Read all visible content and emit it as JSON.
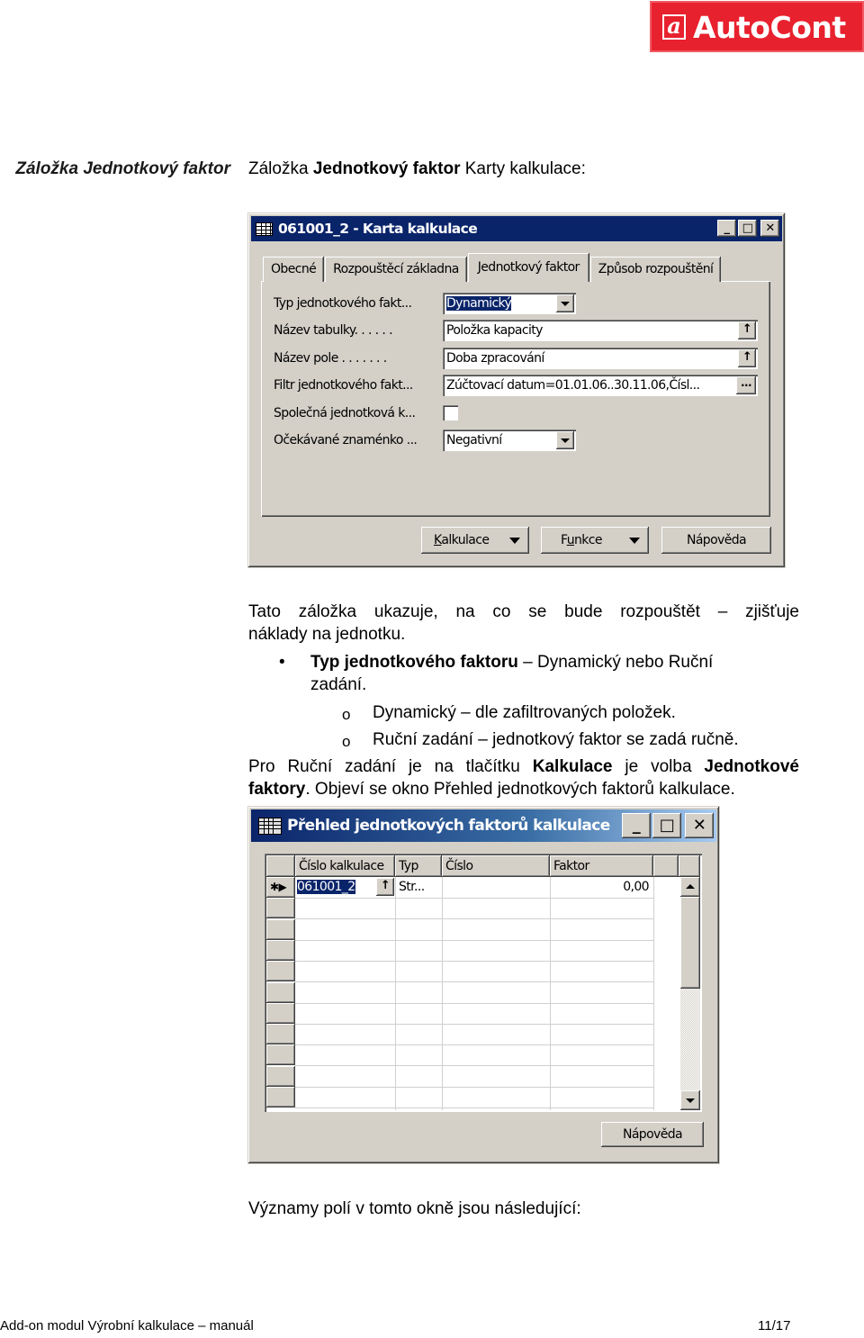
{
  "logo": {
    "mark": "a",
    "text": "AutoCont",
    "color": "#e8212e"
  },
  "side_heading": "Záložka Jednotkový faktor",
  "intro": {
    "prefix": "Záložka ",
    "bold": "Jednotkový faktor",
    "suffix": " Karty kalkulace:"
  },
  "card_window": {
    "title": "061001_2 - Karta kalkulace",
    "title_buttons": {
      "minimize": "_",
      "maximize": "□",
      "close": "✕"
    },
    "tabs": [
      {
        "label": "Obecné",
        "active": false
      },
      {
        "label": "Rozpouštěcí základna",
        "active": false
      },
      {
        "label": "Jednotkový faktor",
        "active": true
      },
      {
        "label": "Způsob rozpouštění",
        "active": false
      }
    ],
    "fields": [
      {
        "label": "Typ jednotkového fakt...",
        "value": "Dynamický",
        "control": "dropdown",
        "selected": true
      },
      {
        "label": "Název tabulky. . . . . .",
        "value": "Položka kapacity",
        "control": "lookup"
      },
      {
        "label": "Název pole . . . . . . .",
        "value": "Doba zpracování",
        "control": "lookup"
      },
      {
        "label": "Filtr jednotkového fakt...",
        "value": "Zúčtovací datum=01.01.06..30.11.06,Čísl...",
        "control": "assist"
      },
      {
        "label": "Společná jednotková k...",
        "value": "",
        "control": "checkbox",
        "checked": false
      },
      {
        "label": "Očekávané znaménko ...",
        "value": "Negativní",
        "control": "dropdown"
      }
    ],
    "buttons": [
      {
        "label": "Kalkulace",
        "accel": "K",
        "rest": "alkulace",
        "dropdown": true
      },
      {
        "label": "Funkce",
        "accel_pre": "F",
        "accel": "u",
        "rest": "nkce",
        "dropdown": true
      },
      {
        "label": "Nápověda",
        "dropdown": false
      }
    ]
  },
  "paragraph1": "Tato záložka ukazuje, na co se bude rozpouštět – zjišťuje",
  "paragraph1_line2": "náklady na jednotku.",
  "bullet": {
    "bold": "Typ jednotkového faktoru",
    "text": " – Dynamický nebo Ruční",
    "line2": "zadání."
  },
  "sub_bullets": [
    "Dynamický – dle zafiltrovaných položek.",
    "Ruční zadání – jednotkový faktor se zadá ručně."
  ],
  "bullet_glyph": "•",
  "sub_bullet_glyph": "o",
  "paragraph2": {
    "part1": "Pro Ruční zadání je na tlačítku ",
    "bold1": "Kalkulace",
    "part2": " je volba ",
    "bold2": "Jednotkové",
    "bold3": "faktory",
    "part3": ". Objeví se okno Přehled jednotkových faktorů kalkulace."
  },
  "overview_window": {
    "title": "Přehled jednotkových faktorů kalkulace",
    "title_buttons": {
      "minimize": "_",
      "maximize": "□",
      "close": "✕"
    },
    "columns": [
      "Číslo kalkulace",
      "Typ",
      "Číslo",
      "Faktor"
    ],
    "rows": [
      {
        "indicator": "✱▶",
        "cislo_kalkulace": "061001_2",
        "typ": "Str...",
        "cislo": "",
        "faktor": "0,00"
      }
    ],
    "empty_rows": 10,
    "help_button": "Nápověda"
  },
  "closing_text": "Významy polí v tomto okně jsou následující:",
  "footer": {
    "left": "Add-on modul Výrobní kalkulace – manuál",
    "page": "11/17"
  }
}
